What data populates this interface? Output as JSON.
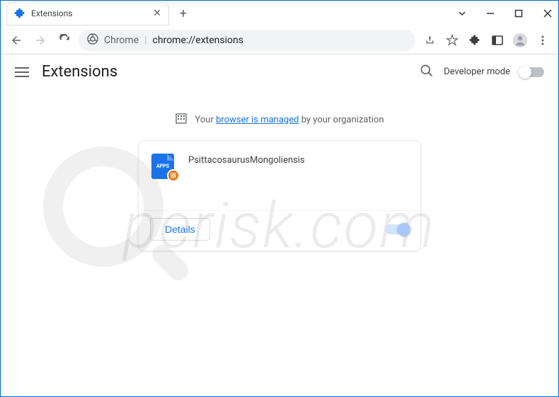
{
  "tab": {
    "title": "Extensions"
  },
  "addressBar": {
    "chromeLabel": "Chrome",
    "url": "chrome://extensions"
  },
  "page": {
    "title": "Extensions",
    "devModeLabel": "Developer mode"
  },
  "managedNotice": {
    "prefix": "Your",
    "link": "browser is managed",
    "suffix": "by your organization"
  },
  "extension": {
    "iconText": "APPS",
    "name": "PsittacosaurusMongoliensis",
    "detailsLabel": "Details"
  },
  "watermark": "pcrisk.com"
}
